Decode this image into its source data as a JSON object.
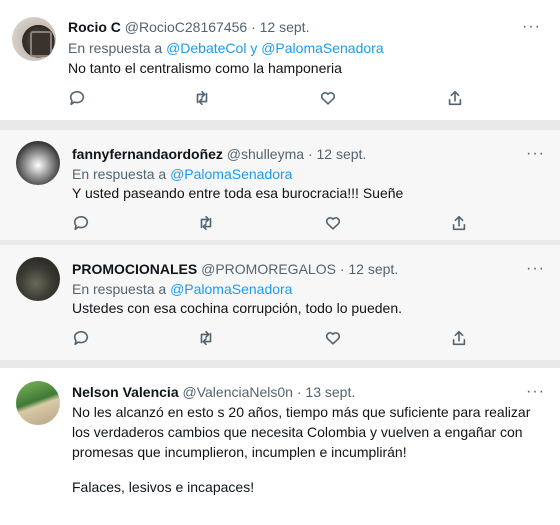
{
  "tweets": [
    {
      "name": "Rocio C",
      "handle": "@RocioC28167456",
      "dot": "·",
      "date": "12 sept.",
      "reply_prefix": "En respuesta a ",
      "reply_mentions": "@DebateCol y @PalomaSenadora",
      "text": "No tanto el centralismo como la hamponeria"
    },
    {
      "name": "fannyfernandaordoñez",
      "handle": "@shulleyma",
      "dot": "·",
      "date": "12 sept.",
      "reply_prefix": "En respuesta a ",
      "reply_mentions": "@PalomaSenadora",
      "text": "Y usted paseando entre toda esa burocracia!!! Sueñe"
    },
    {
      "name": "PROMOCIONALES",
      "handle": "@PROMOREGALOS",
      "dot": "·",
      "date": "12 sept.",
      "reply_prefix": "En respuesta a ",
      "reply_mentions": "@PalomaSenadora",
      "text": "Ustedes con esa cochina corrupción, todo lo pueden."
    },
    {
      "name": "Nelson Valencia",
      "handle": "@ValenciaNels0n",
      "dot": "·",
      "date": "13 sept.",
      "text_lines": [
        "No les alcanzó en esto s 20 años, tiempo más que suficiente para realizar",
        "los verdaderos cambios que necesita Colombia y vuelven a engañar con",
        "promesas que incumplieron, incumplen e incumplirán!"
      ],
      "text2": "Falaces, lesivos e incapaces!"
    }
  ],
  "more_label": "···",
  "icons": [
    "reply-icon",
    "retweet-icon",
    "like-icon",
    "share-icon"
  ]
}
